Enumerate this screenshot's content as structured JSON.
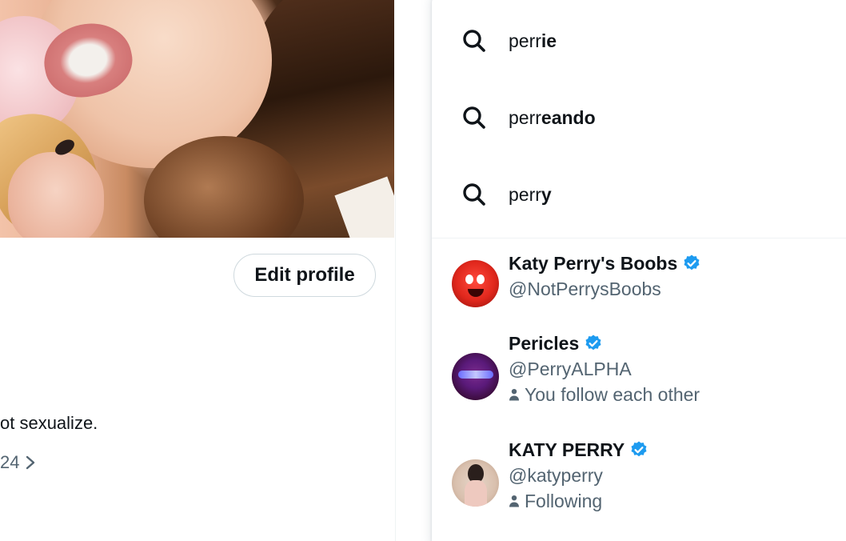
{
  "profile": {
    "edit_button": "Edit profile",
    "bio_fragment": "ot sexualize.",
    "link_fragment": "24"
  },
  "search": {
    "suggestions": [
      {
        "prefix": "perr",
        "completion": "ie"
      },
      {
        "prefix": "perr",
        "completion": "eando"
      },
      {
        "prefix": "perr",
        "completion": "y"
      }
    ],
    "users": [
      {
        "name": "Katy Perry's Boobs",
        "handle": "@NotPerrysBoobs",
        "verified": true,
        "social_context": ""
      },
      {
        "name": "Pericles",
        "handle": "@PerryALPHA",
        "verified": true,
        "social_context": "You follow each other"
      },
      {
        "name": "KATY PERRY",
        "handle": "@katyperry",
        "verified": true,
        "social_context": "Following"
      }
    ]
  },
  "colors": {
    "verified_blue": "#1d9bf0",
    "secondary_text": "#536471",
    "primary_text": "#0f1419"
  }
}
